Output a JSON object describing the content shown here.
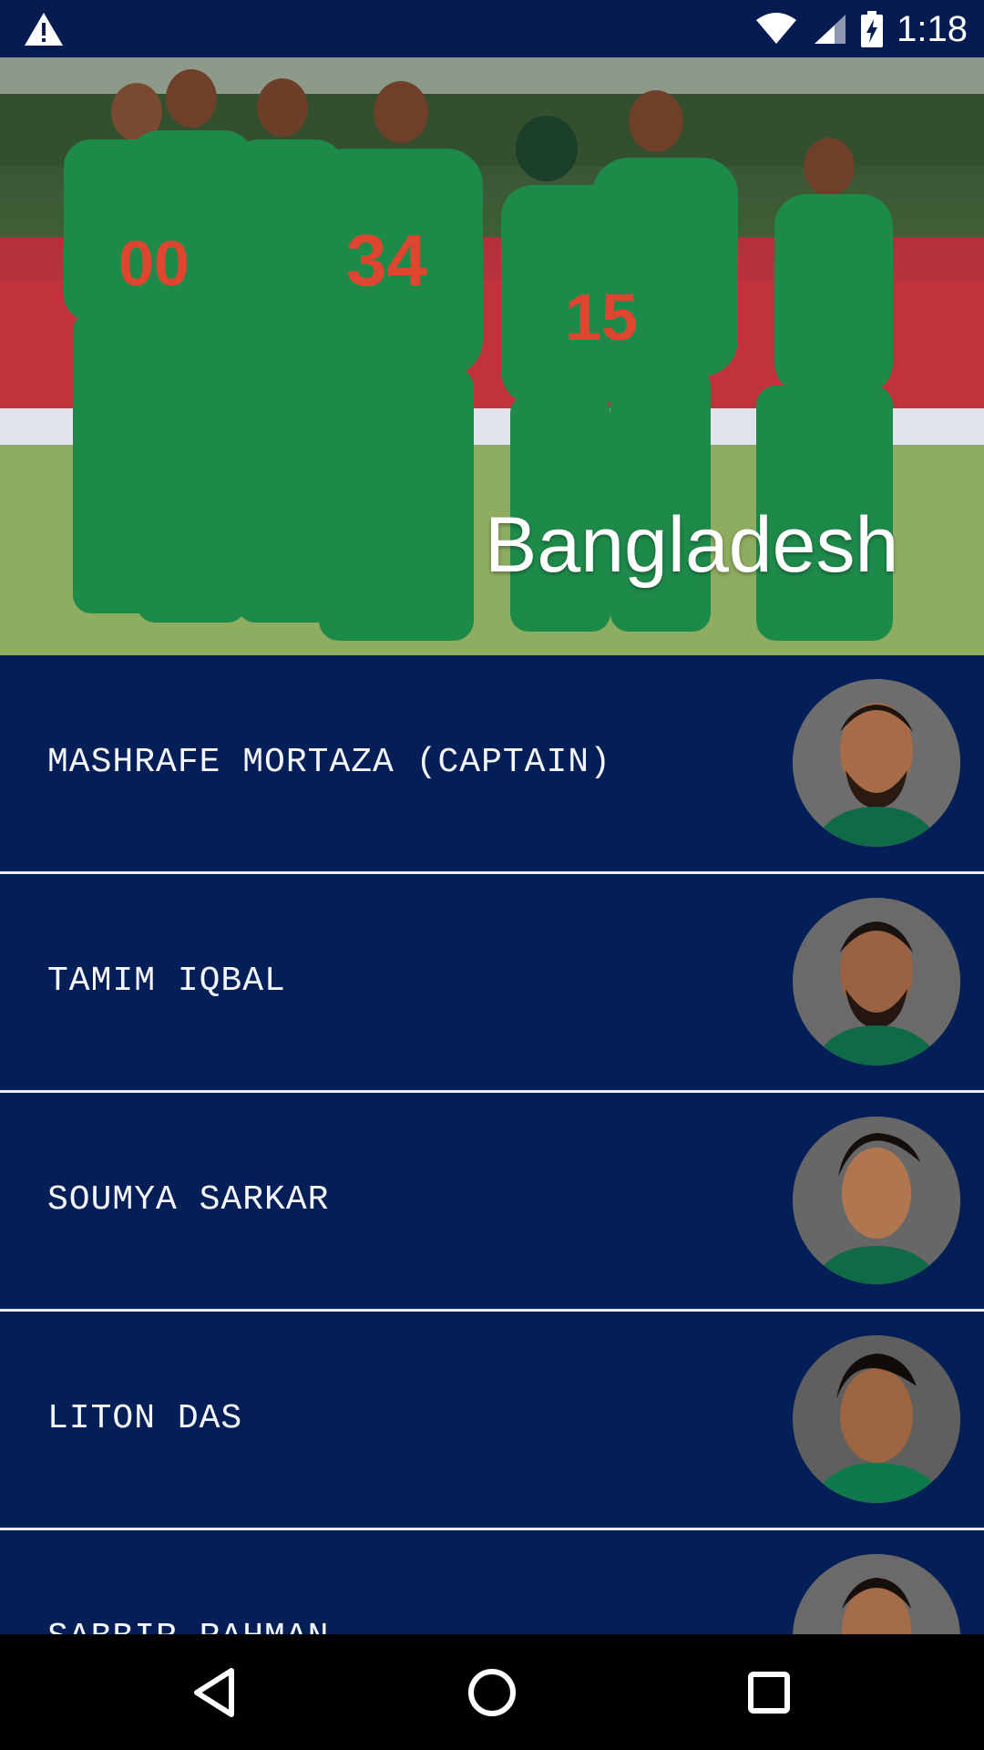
{
  "status_bar": {
    "time": "1:18",
    "icons": [
      "warning-icon",
      "wifi-icon",
      "cell-signal-icon",
      "battery-charging-icon"
    ]
  },
  "header": {
    "title": "Bangladesh",
    "image": "team-photo"
  },
  "players": [
    {
      "name": "MASHRAFE MORTAZA (CAPTAIN)",
      "avatar": "player-photo"
    },
    {
      "name": "TAMIM IQBAL",
      "avatar": "player-photo"
    },
    {
      "name": "SOUMYA SARKAR",
      "avatar": "player-photo"
    },
    {
      "name": "LITON DAS",
      "avatar": "player-photo"
    },
    {
      "name": "SABBIR RAHMAN",
      "avatar": "player-photo"
    }
  ],
  "nav_bar": {
    "icons": [
      "back-icon",
      "home-icon",
      "recents-icon"
    ]
  },
  "colors": {
    "list_background": "#041e57",
    "status_bar": "#041c52",
    "divider": "#e8ecf4",
    "text": "#f4f6fb"
  }
}
